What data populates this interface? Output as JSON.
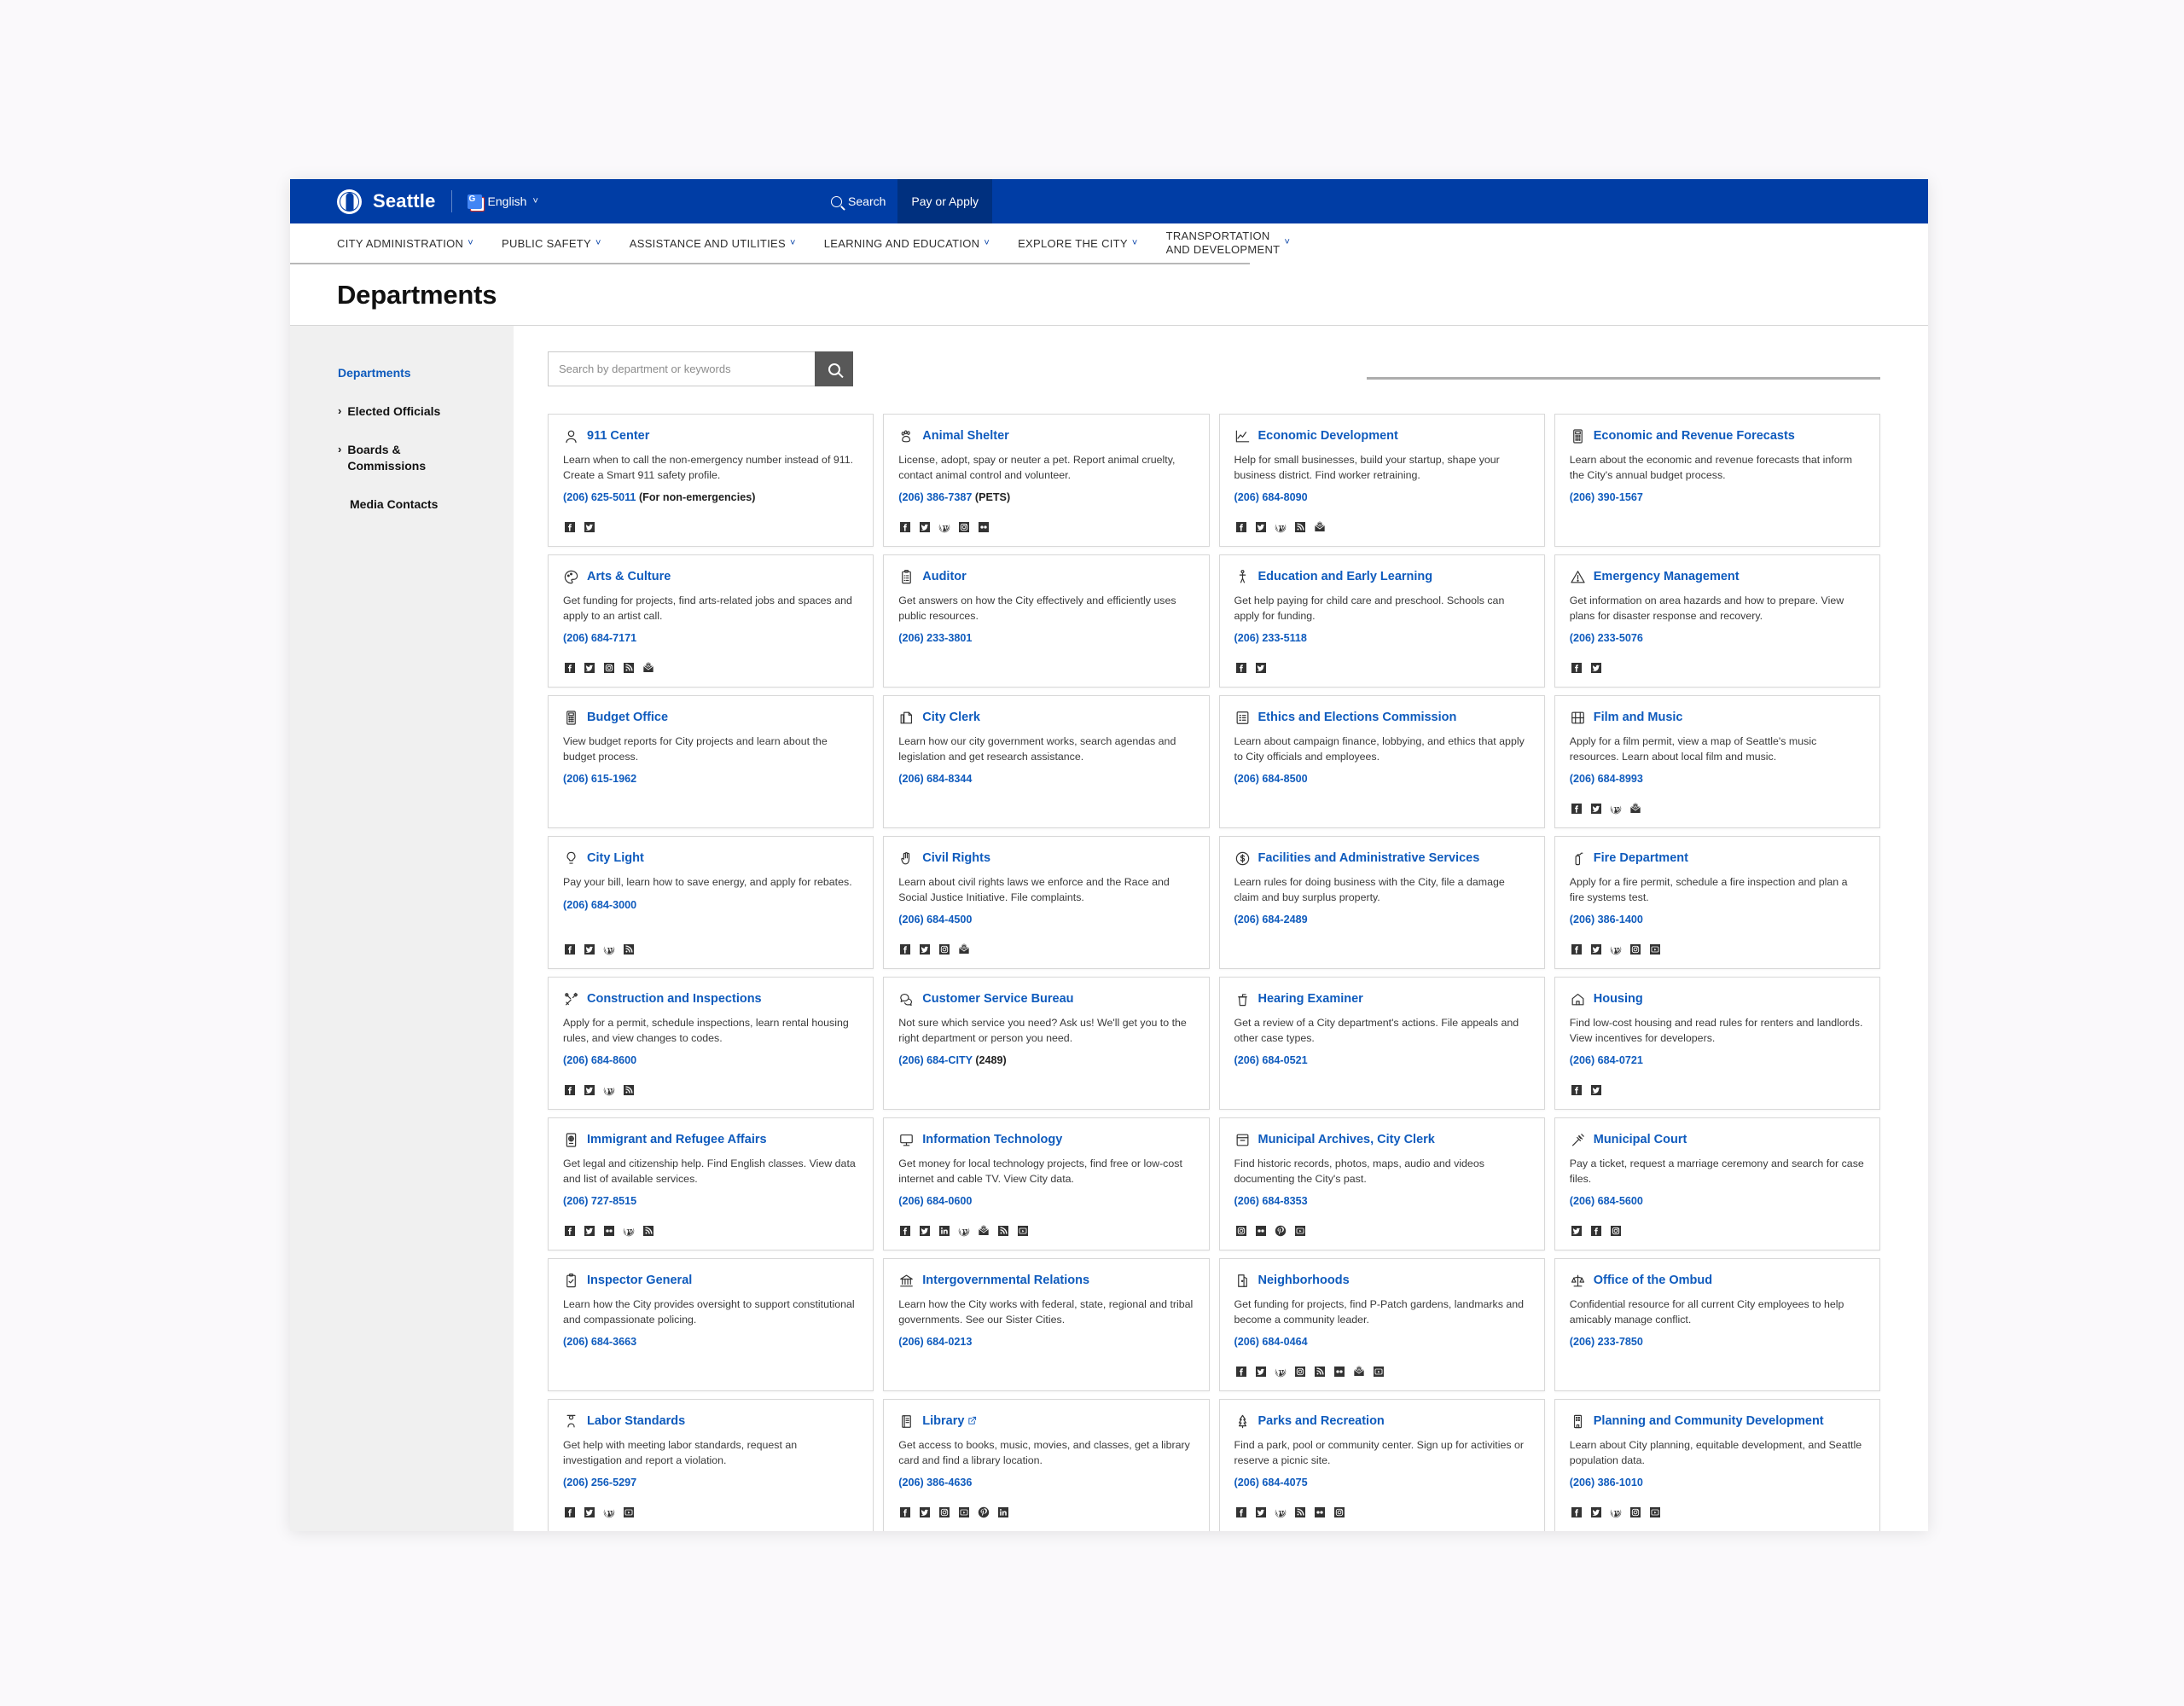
{
  "topbar": {
    "brand": "Seattle",
    "language": "English",
    "search_label": "Search",
    "pay_or_apply_label": "Pay or Apply"
  },
  "nav": {
    "items": [
      {
        "label": "CITY ADMINISTRATION"
      },
      {
        "label": "PUBLIC SAFETY"
      },
      {
        "label": "ASSISTANCE AND UTILITIES"
      },
      {
        "label": "LEARNING AND EDUCATION"
      },
      {
        "label": "EXPLORE THE CITY"
      },
      {
        "label": "TRANSPORTATION",
        "label2": "AND DEVELOPMENT"
      }
    ]
  },
  "page_title": "Departments",
  "sidebar": {
    "items": [
      {
        "label": "Departments",
        "active": true,
        "expandable": false
      },
      {
        "label": "Elected Officials",
        "active": false,
        "expandable": true
      },
      {
        "label": "Boards & Commissions",
        "active": false,
        "expandable": true
      },
      {
        "label": "Media Contacts",
        "active": false,
        "expandable": false
      }
    ]
  },
  "search": {
    "placeholder": "Search by department or keywords",
    "value": "",
    "button_icon": "search-icon"
  },
  "colors": {
    "brand_blue": "#003da5",
    "link_blue": "#0f5bbd",
    "pay_apply_blue": "#00307f",
    "sidebar_gray": "#f0f0f0",
    "search_button_gray": "#585858"
  },
  "departments": [
    {
      "name": "911 Center",
      "icon": "headset-icon",
      "description": "Learn when to call the non-emergency number instead of 911. Create a Smart 911 safety profile.",
      "phone": "(206) 625-5011",
      "phone_suffix": "(For non-emergencies)",
      "external": false,
      "socials": [
        "facebook",
        "twitter"
      ]
    },
    {
      "name": "Animal Shelter",
      "icon": "paw-icon",
      "description": "License, adopt, spay or neuter a pet. Report animal cruelty, contact animal control and volunteer.",
      "phone": "(206) 386-7387",
      "phone_suffix": "(PETS)",
      "external": false,
      "socials": [
        "facebook",
        "twitter",
        "wordpress",
        "instagram",
        "flickr"
      ]
    },
    {
      "name": "Economic Development",
      "icon": "chart-line-icon",
      "description": "Help for small businesses, build your startup, shape your business district. Find worker retraining.",
      "phone": "(206) 684-8090",
      "phone_suffix": "",
      "external": false,
      "socials": [
        "facebook",
        "twitter",
        "wordpress",
        "rss",
        "newsletter"
      ]
    },
    {
      "name": "Economic and Revenue Forecasts",
      "icon": "calculator-icon",
      "description": "Learn about the economic and revenue forecasts that inform the City's annual budget process.",
      "phone": "(206) 390-1567",
      "phone_suffix": "",
      "external": false,
      "socials": []
    },
    {
      "name": "Arts & Culture",
      "icon": "palette-icon",
      "description": "Get funding for projects, find arts-related jobs and spaces and apply to an artist call.",
      "phone": "(206) 684-7171",
      "phone_suffix": "",
      "external": false,
      "socials": [
        "facebook",
        "twitter",
        "instagram",
        "rss",
        "newsletter"
      ]
    },
    {
      "name": "Auditor",
      "icon": "clipboard-list-icon",
      "description": "Get answers on how the City effectively and efficiently uses public resources.",
      "phone": "(206) 233-3801",
      "phone_suffix": "",
      "external": false,
      "socials": []
    },
    {
      "name": "Education and Early Learning",
      "icon": "child-icon",
      "description": "Get help paying for child care and preschool. Schools can apply for funding.",
      "phone": "(206) 233-5118",
      "phone_suffix": "",
      "external": false,
      "socials": [
        "facebook",
        "twitter"
      ]
    },
    {
      "name": "Emergency Management",
      "icon": "warning-triangle-icon",
      "description": "Get information on area hazards and how to prepare. View plans for disaster response and recovery.",
      "phone": "(206) 233-5076",
      "phone_suffix": "",
      "external": false,
      "socials": [
        "facebook",
        "twitter"
      ]
    },
    {
      "name": "Budget Office",
      "icon": "calculator-icon",
      "description": "View budget reports for City projects and learn about the budget process.",
      "phone": "(206) 615-1962",
      "phone_suffix": "",
      "external": false,
      "socials": []
    },
    {
      "name": "City Clerk",
      "icon": "documents-icon",
      "description": "Learn how our city government works, search agendas and legislation and get research assistance.",
      "phone": "(206) 684-8344",
      "phone_suffix": "",
      "external": false,
      "socials": []
    },
    {
      "name": "Ethics and Elections Commission",
      "icon": "list-check-icon",
      "description": "Learn about campaign finance, lobbying, and ethics that apply to City officials and employees.",
      "phone": "(206) 684-8500",
      "phone_suffix": "",
      "external": false,
      "socials": []
    },
    {
      "name": "Film and Music",
      "icon": "film-icon",
      "description": "Apply for a film permit, view a map of Seattle's music resources. Learn about local film and music.",
      "phone": "(206) 684-8993",
      "phone_suffix": "",
      "external": false,
      "socials": [
        "facebook",
        "twitter",
        "wordpress",
        "newsletter"
      ]
    },
    {
      "name": "City Light",
      "icon": "lightbulb-icon",
      "description": "Pay your bill, learn how to save energy, and apply for rebates.",
      "phone": "(206) 684-3000",
      "phone_suffix": "",
      "external": false,
      "socials": [
        "facebook",
        "twitter",
        "wordpress",
        "rss"
      ]
    },
    {
      "name": "Civil Rights",
      "icon": "raised-hand-icon",
      "description": "Learn about civil rights laws we enforce and the Race and Social Justice Initiative. File complaints.",
      "phone": "(206) 684-4500",
      "phone_suffix": "",
      "external": false,
      "socials": [
        "facebook",
        "twitter",
        "instagram",
        "newsletter"
      ]
    },
    {
      "name": "Facilities and Administrative Services",
      "icon": "dollar-circle-icon",
      "description": "Learn rules for doing business with the City, file a damage claim and buy surplus property.",
      "phone": "(206) 684-2489",
      "phone_suffix": "",
      "external": false,
      "socials": []
    },
    {
      "name": "Fire Department",
      "icon": "fire-extinguisher-icon",
      "description": "Apply for a fire permit, schedule a fire inspection and plan a fire systems test.",
      "phone": "(206) 386-1400",
      "phone_suffix": "",
      "external": false,
      "socials": [
        "facebook",
        "twitter",
        "wordpress",
        "instagram",
        "youtube"
      ]
    },
    {
      "name": "Construction and Inspections",
      "icon": "tools-icon",
      "description": "Apply for a permit, schedule inspections, learn rental housing rules, and view changes to codes.",
      "phone": "(206) 684-8600",
      "phone_suffix": "",
      "external": false,
      "socials": [
        "facebook",
        "twitter",
        "wordpress",
        "rss"
      ]
    },
    {
      "name": "Customer Service Bureau",
      "icon": "speech-bubbles-icon",
      "description": "Not sure which service you need? Ask us! We'll get you to the right department or person you need.",
      "phone": "(206) 684-CITY",
      "phone_suffix": "(2489)",
      "external": false,
      "socials": []
    },
    {
      "name": "Hearing Examiner",
      "icon": "podium-icon",
      "description": "Get a review of a City department's actions. File appeals and other case types.",
      "phone": "(206) 684-0521",
      "phone_suffix": "",
      "external": false,
      "socials": []
    },
    {
      "name": "Housing",
      "icon": "house-icon",
      "description": "Find low-cost housing and read rules for renters and landlords. View incentives for developers.",
      "phone": "(206) 684-0721",
      "phone_suffix": "",
      "external": false,
      "socials": [
        "facebook",
        "twitter"
      ]
    },
    {
      "name": "Immigrant and Refugee Affairs",
      "icon": "passport-icon",
      "description": "Get legal and citizenship help. Find English classes. View data and list of available services.",
      "phone": "(206) 727-8515",
      "phone_suffix": "",
      "external": false,
      "socials": [
        "facebook",
        "twitter",
        "flickr",
        "wordpress",
        "rss"
      ]
    },
    {
      "name": "Information Technology",
      "icon": "monitor-icon",
      "description": "Get money for local technology projects, find free or low-cost internet and cable TV. View City data.",
      "phone": "(206) 684-0600",
      "phone_suffix": "",
      "external": false,
      "socials": [
        "facebook",
        "twitter",
        "linkedin",
        "wordpress",
        "newsletter",
        "rss",
        "youtube"
      ]
    },
    {
      "name": "Municipal Archives, City Clerk",
      "icon": "archive-box-icon",
      "description": "Find historic records, photos, maps, audio and videos documenting the City's past.",
      "phone": "(206) 684-8353",
      "phone_suffix": "",
      "external": false,
      "socials": [
        "instagram",
        "flickr",
        "pinterest",
        "youtube"
      ]
    },
    {
      "name": "Municipal Court",
      "icon": "gavel-icon",
      "description": "Pay a ticket, request a marriage ceremony and search for case files.",
      "phone": "(206) 684-5600",
      "phone_suffix": "",
      "external": false,
      "socials": [
        "twitter",
        "facebook",
        "instagram"
      ]
    },
    {
      "name": "Inspector General",
      "icon": "clipboard-check-icon",
      "description": "Learn how the City provides oversight to support constitutional and compassionate policing.",
      "phone": "(206) 684-3663",
      "phone_suffix": "",
      "external": false,
      "socials": []
    },
    {
      "name": "Intergovernmental Relations",
      "icon": "bank-icon",
      "description": "Learn how the City works with federal, state, regional and tribal governments. See our Sister Cities.",
      "phone": "(206) 684-0213",
      "phone_suffix": "",
      "external": false,
      "socials": []
    },
    {
      "name": "Neighborhoods",
      "icon": "door-icon",
      "description": "Get funding for projects, find P-Patch gardens, landmarks and become a community leader.",
      "phone": "(206) 684-0464",
      "phone_suffix": "",
      "external": false,
      "socials": [
        "facebook",
        "twitter",
        "wordpress",
        "instagram",
        "rss",
        "flickr",
        "newsletter",
        "youtube"
      ]
    },
    {
      "name": "Office of the Ombud",
      "icon": "scales-icon",
      "description": "Confidential resource for all current City employees to help amicably manage conflict.",
      "phone": "(206) 233-7850",
      "phone_suffix": "",
      "external": false,
      "socials": []
    },
    {
      "name": "Labor Standards",
      "icon": "worker-icon",
      "description": "Get help with meeting labor standards, request an investigation and report a violation.",
      "phone": "(206) 256-5297",
      "phone_suffix": "",
      "external": false,
      "socials": [
        "facebook",
        "twitter",
        "wordpress",
        "youtube"
      ]
    },
    {
      "name": "Library",
      "icon": "book-icon",
      "description": "Get access to books, music, movies, and classes, get a library card and find a library location.",
      "phone": "(206) 386-4636",
      "phone_suffix": "",
      "external": true,
      "socials": [
        "facebook",
        "twitter",
        "instagram",
        "youtube",
        "pinterest",
        "linkedin"
      ]
    },
    {
      "name": "Parks and Recreation",
      "icon": "tree-icon",
      "description": "Find a park, pool or community center. Sign up for activities or reserve a picnic site.",
      "phone": "(206) 684-4075",
      "phone_suffix": "",
      "external": false,
      "socials": [
        "facebook",
        "twitter",
        "wordpress",
        "rss",
        "flickr",
        "instagram"
      ]
    },
    {
      "name": "Planning and Community Development",
      "icon": "building-icon",
      "description": "Learn about City planning, equitable development, and Seattle population data.",
      "phone": "(206) 386-1010",
      "phone_suffix": "",
      "external": false,
      "socials": [
        "facebook",
        "twitter",
        "wordpress",
        "instagram",
        "youtube"
      ]
    }
  ]
}
